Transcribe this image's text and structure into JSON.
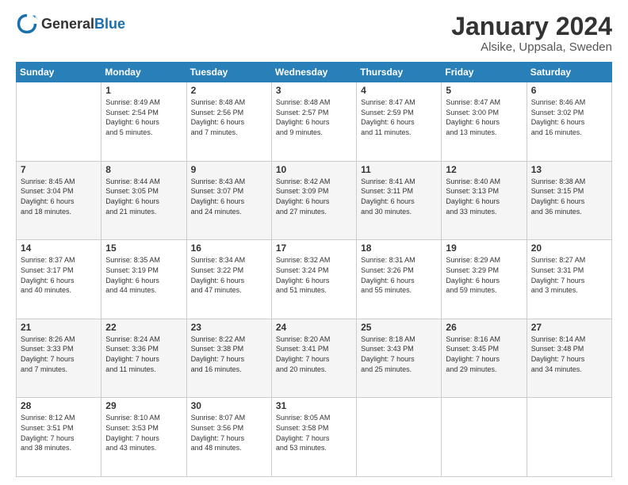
{
  "header": {
    "logo": {
      "general": "General",
      "blue": "Blue"
    },
    "title": "January 2024",
    "subtitle": "Alsike, Uppsala, Sweden"
  },
  "columns": [
    "Sunday",
    "Monday",
    "Tuesday",
    "Wednesday",
    "Thursday",
    "Friday",
    "Saturday"
  ],
  "weeks": [
    [
      {
        "day": "",
        "info": ""
      },
      {
        "day": "1",
        "info": "Sunrise: 8:49 AM\nSunset: 2:54 PM\nDaylight: 6 hours\nand 5 minutes."
      },
      {
        "day": "2",
        "info": "Sunrise: 8:48 AM\nSunset: 2:56 PM\nDaylight: 6 hours\nand 7 minutes."
      },
      {
        "day": "3",
        "info": "Sunrise: 8:48 AM\nSunset: 2:57 PM\nDaylight: 6 hours\nand 9 minutes."
      },
      {
        "day": "4",
        "info": "Sunrise: 8:47 AM\nSunset: 2:59 PM\nDaylight: 6 hours\nand 11 minutes."
      },
      {
        "day": "5",
        "info": "Sunrise: 8:47 AM\nSunset: 3:00 PM\nDaylight: 6 hours\nand 13 minutes."
      },
      {
        "day": "6",
        "info": "Sunrise: 8:46 AM\nSunset: 3:02 PM\nDaylight: 6 hours\nand 16 minutes."
      }
    ],
    [
      {
        "day": "7",
        "info": "Sunrise: 8:45 AM\nSunset: 3:04 PM\nDaylight: 6 hours\nand 18 minutes."
      },
      {
        "day": "8",
        "info": "Sunrise: 8:44 AM\nSunset: 3:05 PM\nDaylight: 6 hours\nand 21 minutes."
      },
      {
        "day": "9",
        "info": "Sunrise: 8:43 AM\nSunset: 3:07 PM\nDaylight: 6 hours\nand 24 minutes."
      },
      {
        "day": "10",
        "info": "Sunrise: 8:42 AM\nSunset: 3:09 PM\nDaylight: 6 hours\nand 27 minutes."
      },
      {
        "day": "11",
        "info": "Sunrise: 8:41 AM\nSunset: 3:11 PM\nDaylight: 6 hours\nand 30 minutes."
      },
      {
        "day": "12",
        "info": "Sunrise: 8:40 AM\nSunset: 3:13 PM\nDaylight: 6 hours\nand 33 minutes."
      },
      {
        "day": "13",
        "info": "Sunrise: 8:38 AM\nSunset: 3:15 PM\nDaylight: 6 hours\nand 36 minutes."
      }
    ],
    [
      {
        "day": "14",
        "info": "Sunrise: 8:37 AM\nSunset: 3:17 PM\nDaylight: 6 hours\nand 40 minutes."
      },
      {
        "day": "15",
        "info": "Sunrise: 8:35 AM\nSunset: 3:19 PM\nDaylight: 6 hours\nand 44 minutes."
      },
      {
        "day": "16",
        "info": "Sunrise: 8:34 AM\nSunset: 3:22 PM\nDaylight: 6 hours\nand 47 minutes."
      },
      {
        "day": "17",
        "info": "Sunrise: 8:32 AM\nSunset: 3:24 PM\nDaylight: 6 hours\nand 51 minutes."
      },
      {
        "day": "18",
        "info": "Sunrise: 8:31 AM\nSunset: 3:26 PM\nDaylight: 6 hours\nand 55 minutes."
      },
      {
        "day": "19",
        "info": "Sunrise: 8:29 AM\nSunset: 3:29 PM\nDaylight: 6 hours\nand 59 minutes."
      },
      {
        "day": "20",
        "info": "Sunrise: 8:27 AM\nSunset: 3:31 PM\nDaylight: 7 hours\nand 3 minutes."
      }
    ],
    [
      {
        "day": "21",
        "info": "Sunrise: 8:26 AM\nSunset: 3:33 PM\nDaylight: 7 hours\nand 7 minutes."
      },
      {
        "day": "22",
        "info": "Sunrise: 8:24 AM\nSunset: 3:36 PM\nDaylight: 7 hours\nand 11 minutes."
      },
      {
        "day": "23",
        "info": "Sunrise: 8:22 AM\nSunset: 3:38 PM\nDaylight: 7 hours\nand 16 minutes."
      },
      {
        "day": "24",
        "info": "Sunrise: 8:20 AM\nSunset: 3:41 PM\nDaylight: 7 hours\nand 20 minutes."
      },
      {
        "day": "25",
        "info": "Sunrise: 8:18 AM\nSunset: 3:43 PM\nDaylight: 7 hours\nand 25 minutes."
      },
      {
        "day": "26",
        "info": "Sunrise: 8:16 AM\nSunset: 3:45 PM\nDaylight: 7 hours\nand 29 minutes."
      },
      {
        "day": "27",
        "info": "Sunrise: 8:14 AM\nSunset: 3:48 PM\nDaylight: 7 hours\nand 34 minutes."
      }
    ],
    [
      {
        "day": "28",
        "info": "Sunrise: 8:12 AM\nSunset: 3:51 PM\nDaylight: 7 hours\nand 38 minutes."
      },
      {
        "day": "29",
        "info": "Sunrise: 8:10 AM\nSunset: 3:53 PM\nDaylight: 7 hours\nand 43 minutes."
      },
      {
        "day": "30",
        "info": "Sunrise: 8:07 AM\nSunset: 3:56 PM\nDaylight: 7 hours\nand 48 minutes."
      },
      {
        "day": "31",
        "info": "Sunrise: 8:05 AM\nSunset: 3:58 PM\nDaylight: 7 hours\nand 53 minutes."
      },
      {
        "day": "",
        "info": ""
      },
      {
        "day": "",
        "info": ""
      },
      {
        "day": "",
        "info": ""
      }
    ]
  ]
}
